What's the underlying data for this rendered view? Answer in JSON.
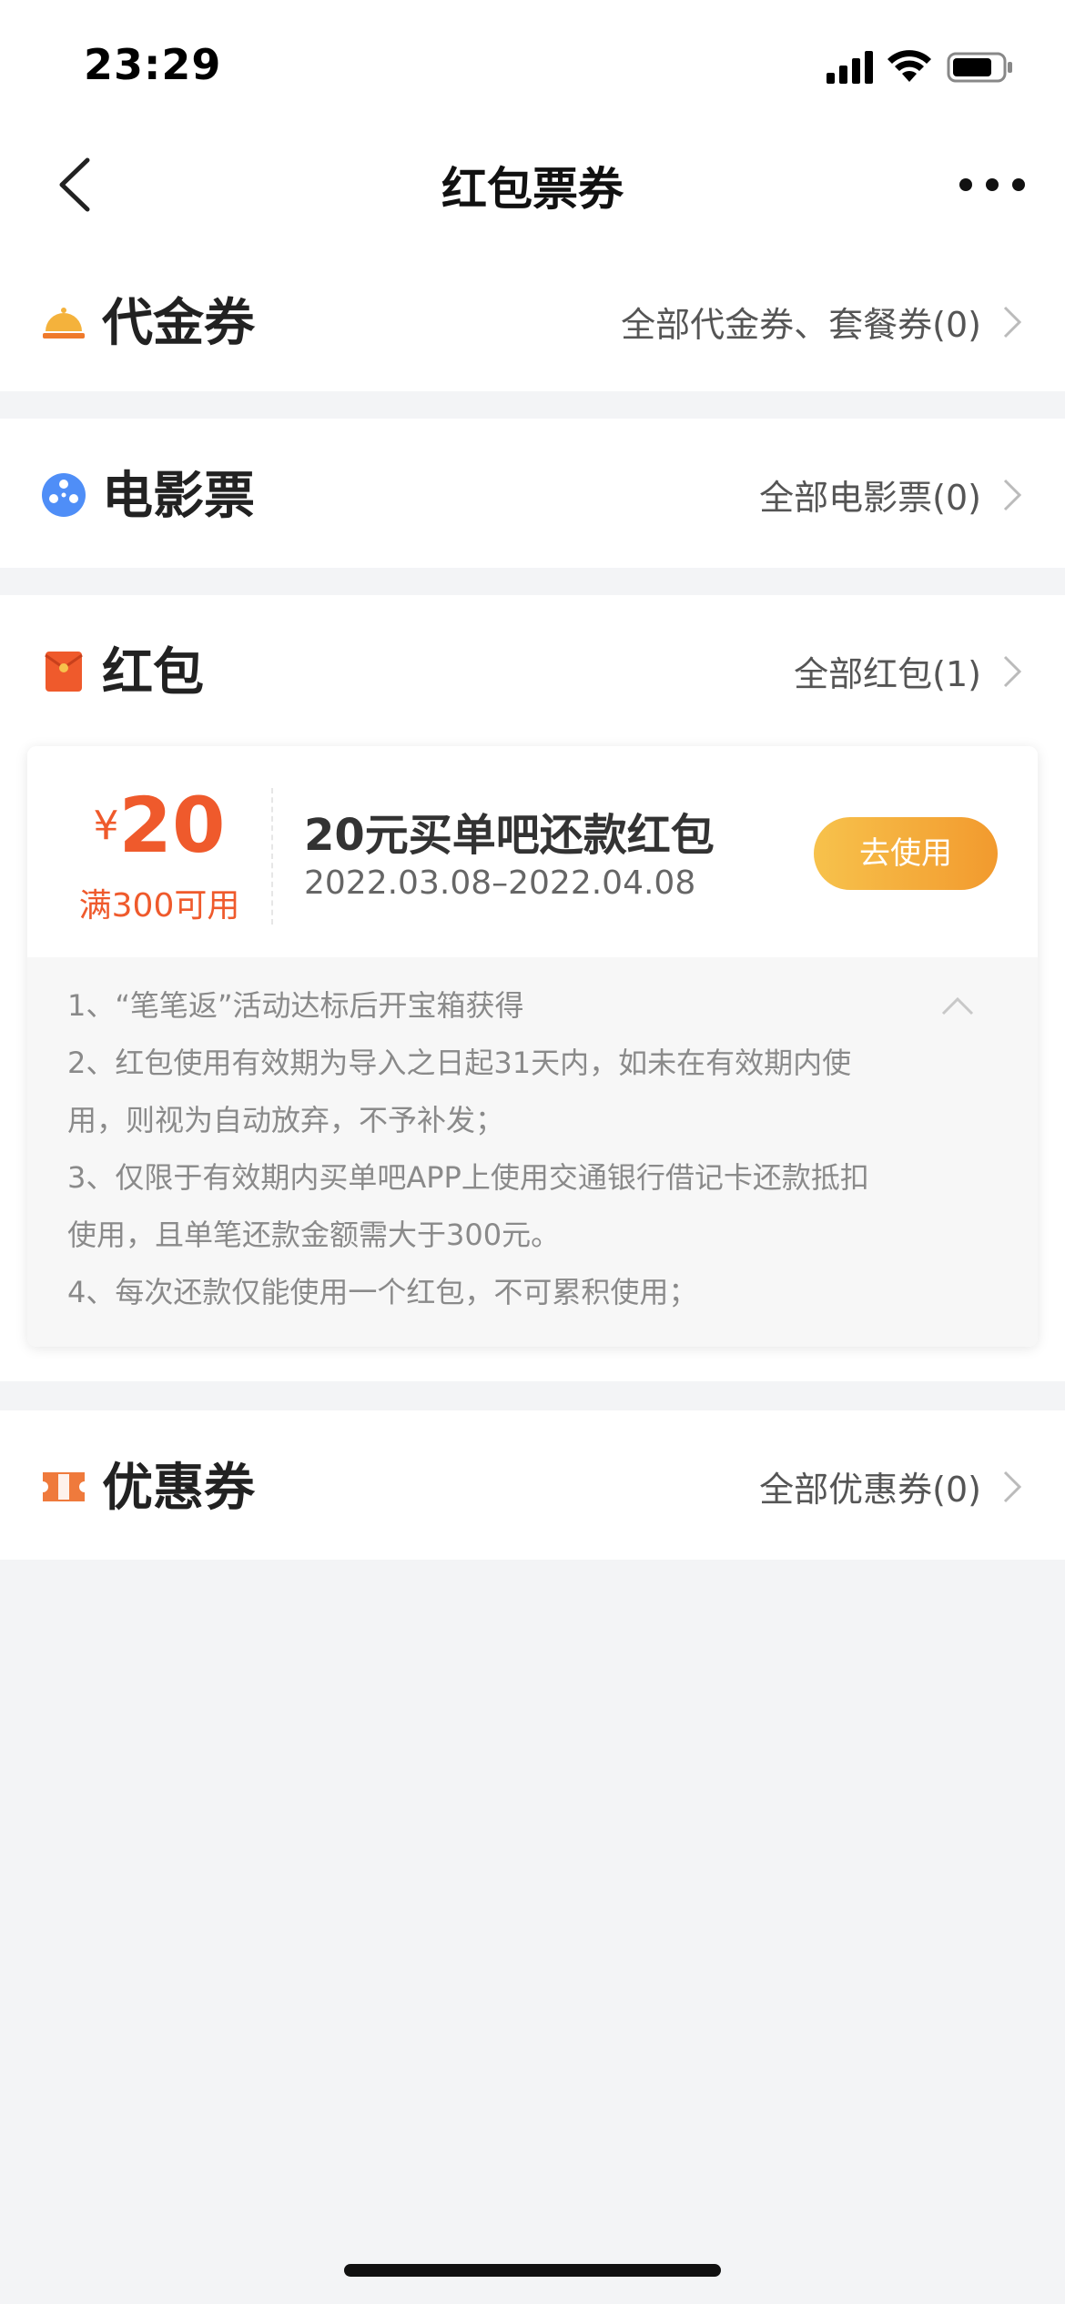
{
  "status_bar": {
    "time": "23:29"
  },
  "nav": {
    "title": "红包票券"
  },
  "sections": [
    {
      "title": "代金券",
      "link": "全部代金券、套餐券(0)",
      "icon": "bell-icon"
    },
    {
      "title": "电影票",
      "link": "全部电影票(0)",
      "icon": "film-reel-icon"
    },
    {
      "title": "红包",
      "link": "全部红包(1)",
      "icon": "red-envelope-icon"
    },
    {
      "title": "优惠券",
      "link": "全部优惠券(0)",
      "icon": "ticket-icon"
    }
  ],
  "red_packet": {
    "currency": "¥",
    "amount": "20",
    "threshold": "满300可用",
    "title": "20元买单吧还款红包",
    "date": "2022.03.08–2022.04.08",
    "button": "去使用",
    "rules": [
      "1、“笔笔返”活动达标后开宝箱获得",
      "2、红包使用有效期为导入之日起31天内，如未在有效期内使",
      "用，则视为自动放弃，不予补发；",
      "3、仅限于有效期内买单吧APP上使用交通银行借记卡还款抵扣",
      "使用，且单笔还款金额需大于300元。",
      "4、每次还款仅能使用一个红包，不可累积使用；"
    ]
  },
  "colors": {
    "accent": "#ef5a2c",
    "button": "#f4a93a",
    "background": "#f3f4f6"
  }
}
